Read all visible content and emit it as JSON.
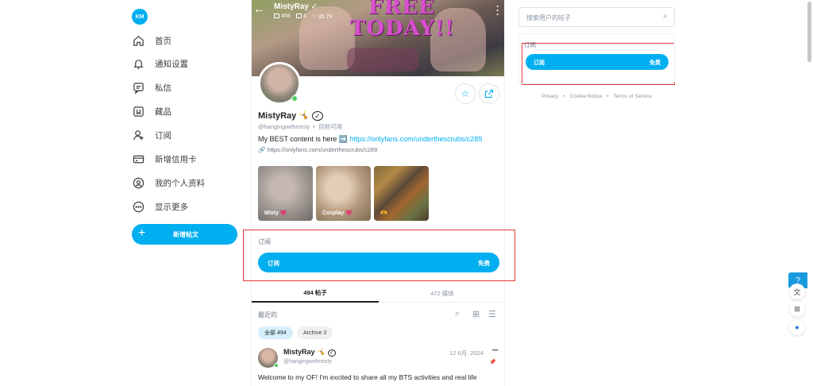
{
  "sidebar": {
    "avatar_initials": "KM",
    "items": [
      {
        "label": "首页",
        "icon": "home-icon"
      },
      {
        "label": "通知设置",
        "icon": "bell-icon"
      },
      {
        "label": "私信",
        "icon": "message-icon"
      },
      {
        "label": "藏品",
        "icon": "bookmark-icon"
      },
      {
        "label": "订阅",
        "icon": "subscriptions-icon"
      },
      {
        "label": "新增信用卡",
        "icon": "credit-card-icon"
      },
      {
        "label": "我的个人资料",
        "icon": "profile-icon"
      },
      {
        "label": "显示更多",
        "icon": "more-icon"
      }
    ],
    "new_post_label": "新增帖文"
  },
  "cover": {
    "name": "MistyRay",
    "stats": {
      "posts": "468",
      "videos": "4",
      "likes": "35.7K"
    },
    "banner_line1": "FREE",
    "banner_line2": "TODAY!!"
  },
  "profile": {
    "name": "MistyRay 🤸",
    "handle": "@hangingwithmisty",
    "status": "目前可用",
    "bio_prefix": "My BEST content is here ➡️",
    "bio_link": "https://onlyfans.com/underthescrubs/c289",
    "website": "https://onlyfans.com/underthescrubs/c289"
  },
  "highlights": [
    {
      "label": "Misty 💗"
    },
    {
      "label": "Cosplay 💗"
    },
    {
      "label": "🫶"
    }
  ],
  "subscription": {
    "title": "订阅",
    "button_label": "订阅",
    "price": "免费"
  },
  "tabs": {
    "posts": "494 帖子",
    "media": "472 媒体"
  },
  "feed": {
    "recent_label": "最近的",
    "filter_all": "全部 494",
    "filter_archive": "Archive 3"
  },
  "post": {
    "name": "MistyRay 🤸",
    "handle": "@hangingwithmisty",
    "date": "12 6月, 2024",
    "text": "Welcome to my OF! I'm excited to share all my BTS activities and real life"
  },
  "right": {
    "search_placeholder": "搜索用户的帖子",
    "sub_title": "订阅",
    "sub_button_label": "订阅",
    "sub_price": "免费",
    "footer": [
      "Privacy",
      "Cookie Notice",
      "Terms of Service"
    ]
  },
  "colors": {
    "accent": "#00aff0",
    "highlight_box": "#e23a3a",
    "online": "#4ecc5f"
  }
}
